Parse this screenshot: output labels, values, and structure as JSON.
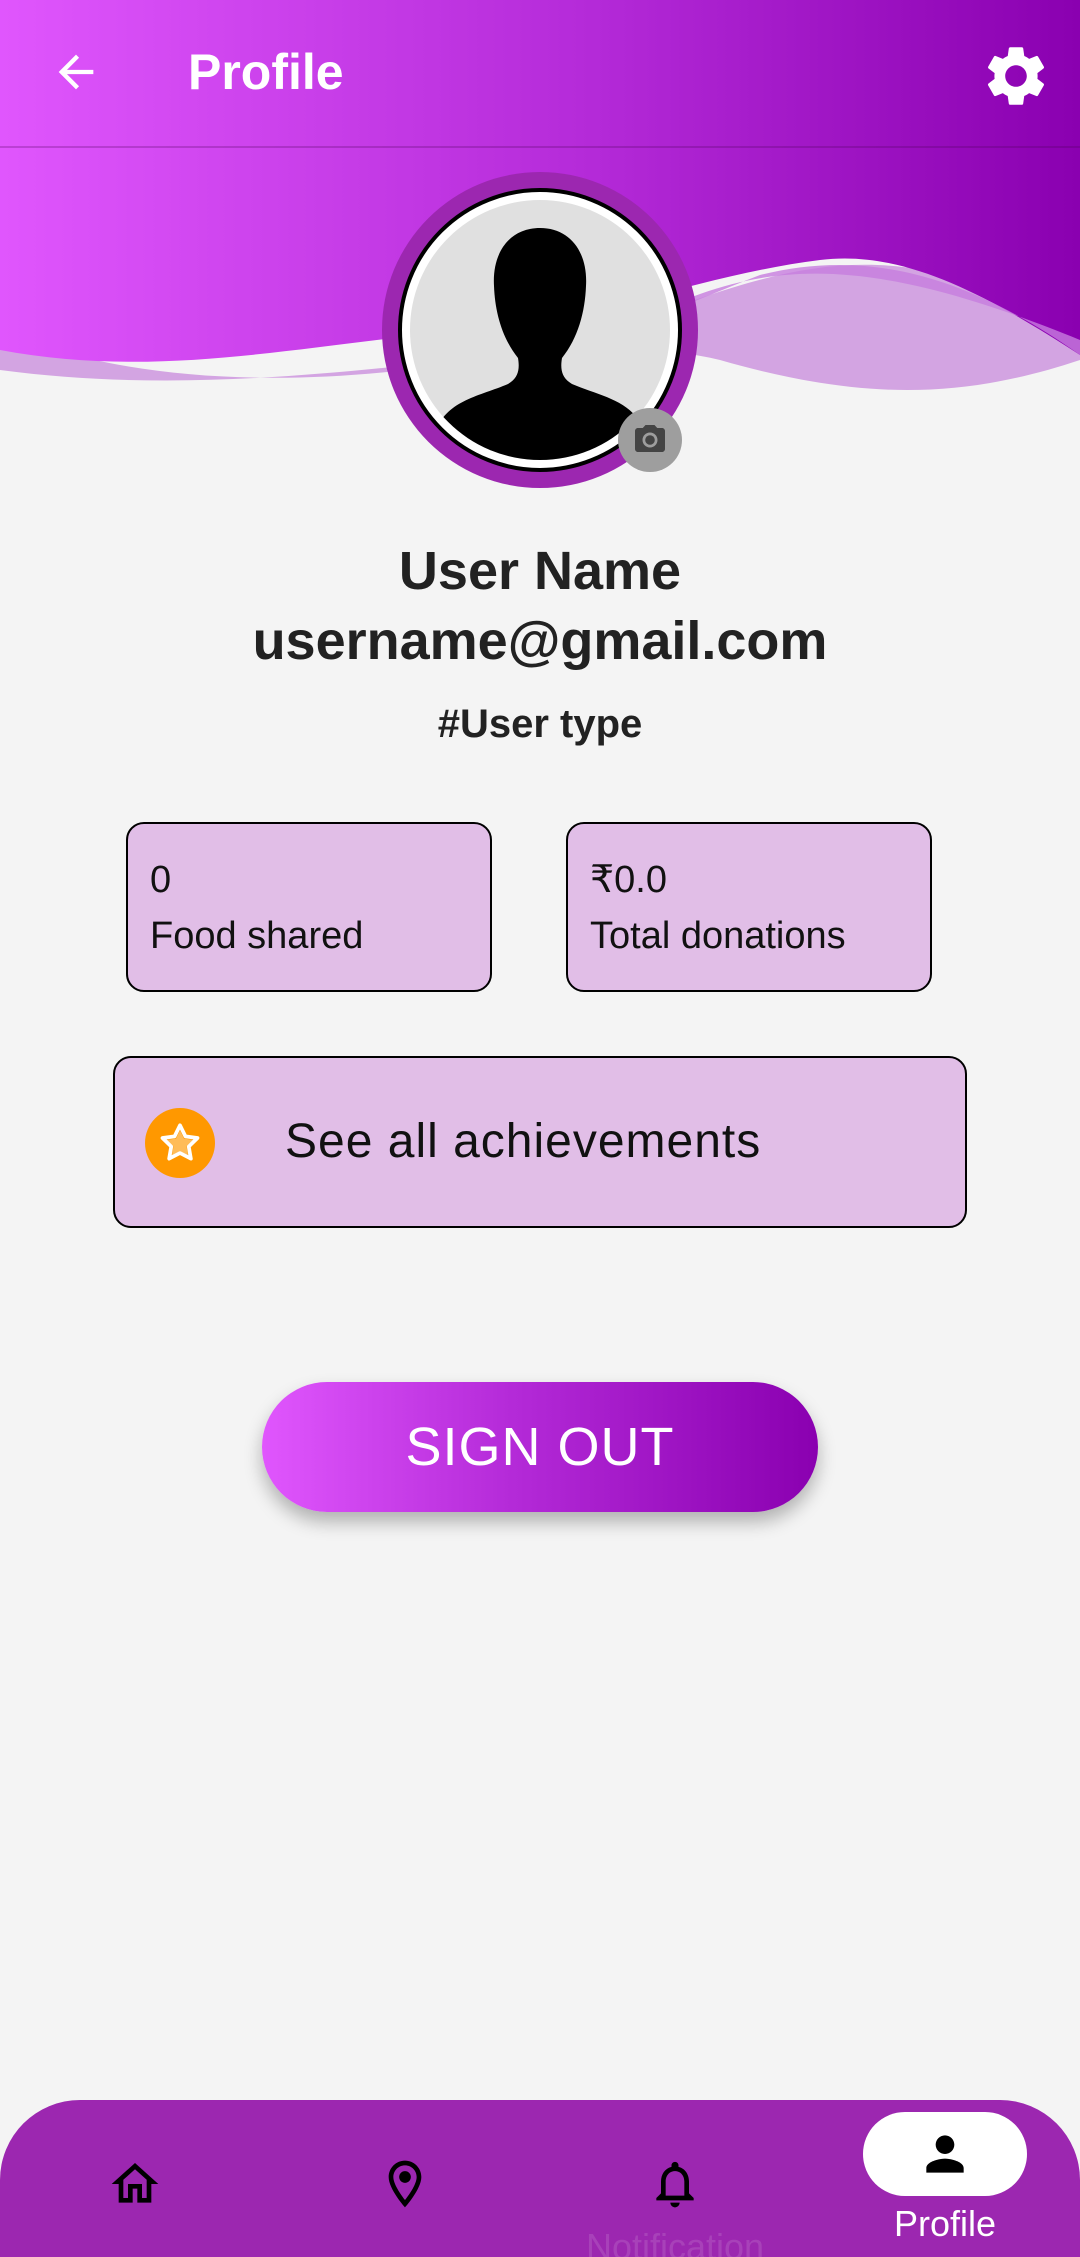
{
  "colors": {
    "gradient_start": "#e056fd",
    "gradient_end": "#8a00b0",
    "accent_purple": "#9c27b0",
    "card_fill": "#e1bee7",
    "star_orange": "#ff9800",
    "background": "#f4f4f4"
  },
  "appbar": {
    "title": "Profile",
    "back_icon": "arrow-back-icon",
    "settings_icon": "gear-icon"
  },
  "profile": {
    "avatar_icon": "person-silhouette-icon",
    "camera_icon": "camera-icon",
    "name": "User Name",
    "email": "username@gmail.com",
    "user_type": "#User type"
  },
  "stats": {
    "food_shared": {
      "value": "0",
      "label": "Food shared"
    },
    "total_donations": {
      "value": "₹0.0",
      "label": "Total donations"
    }
  },
  "achievements": {
    "icon": "star-icon",
    "label": "See all achievements"
  },
  "signout": {
    "label": "SIGN OUT"
  },
  "bottom_nav": {
    "items": [
      {
        "icon": "home-icon",
        "label": ""
      },
      {
        "icon": "location-pin-icon",
        "label": ""
      },
      {
        "icon": "bell-icon",
        "label": "Notification"
      },
      {
        "icon": "person-icon",
        "label": "Profile"
      }
    ],
    "active_index": 3
  }
}
